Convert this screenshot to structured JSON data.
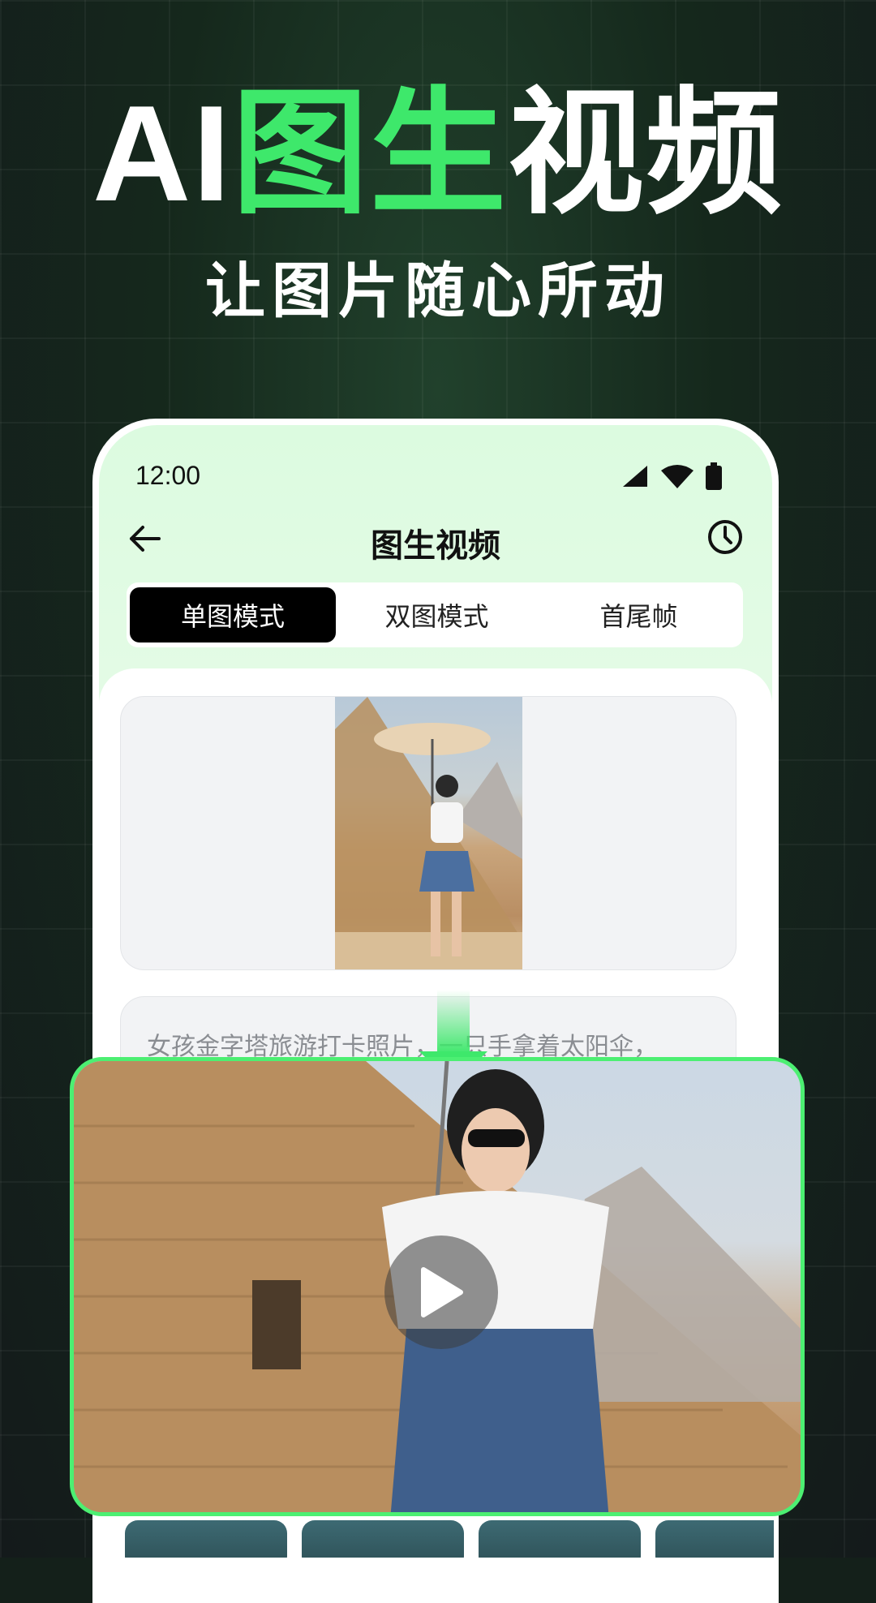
{
  "hero": {
    "title_prefix": "AI",
    "title_highlight": "图生",
    "title_suffix": "视频",
    "subtitle": "让图片随心所动"
  },
  "statusbar": {
    "time": "12:00"
  },
  "appbar": {
    "title": "图生视频"
  },
  "tabs": [
    {
      "label": "单图模式",
      "active": true
    },
    {
      "label": "双图模式",
      "active": false
    },
    {
      "label": "首尾帧",
      "active": false
    }
  ],
  "prompt": {
    "text": "女孩金字塔旅游打卡照片，一只手拿着太阳伞，"
  },
  "colors": {
    "accent": "#3ee86b",
    "border": "#4cef72"
  },
  "icons": [
    "back-arrow-icon",
    "history-clock-icon",
    "signal-icon",
    "wifi-icon",
    "battery-icon",
    "play-icon",
    "down-arrow-icon"
  ]
}
